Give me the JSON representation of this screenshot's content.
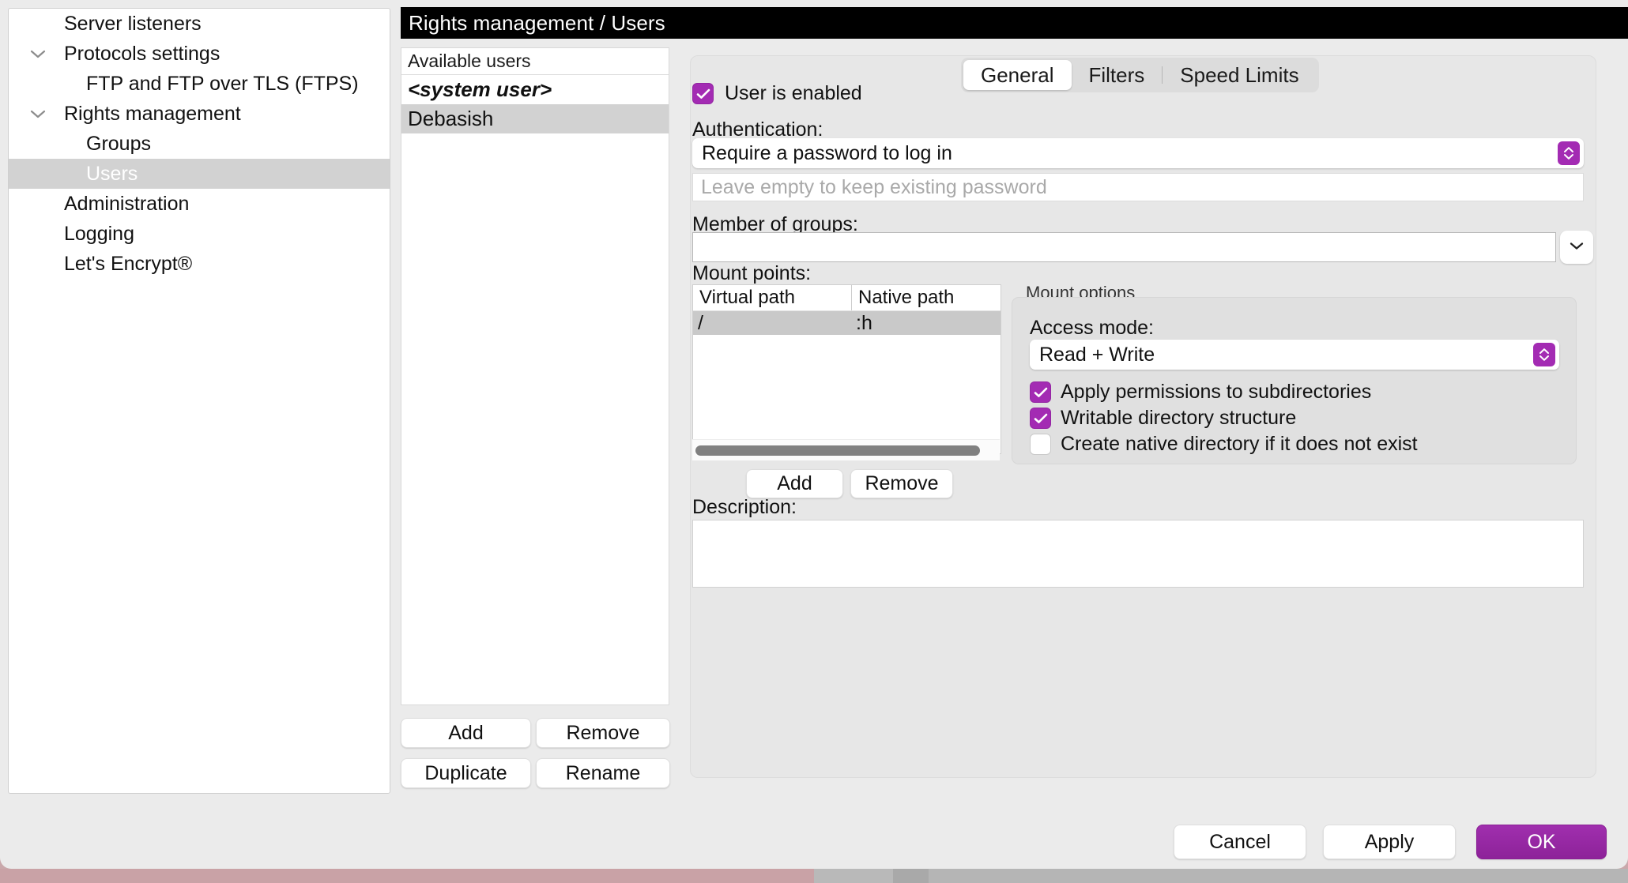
{
  "header": {
    "title": "Rights management / Users"
  },
  "sidebar": {
    "items": [
      {
        "label": "Server listeners",
        "indent": 1,
        "twisty": false,
        "selected": false
      },
      {
        "label": "Protocols settings",
        "indent": 1,
        "twisty": true,
        "selected": false
      },
      {
        "label": "FTP and FTP over TLS (FTPS)",
        "indent": 2,
        "twisty": false,
        "selected": false
      },
      {
        "label": "Rights management",
        "indent": 1,
        "twisty": true,
        "selected": false
      },
      {
        "label": "Groups",
        "indent": 2,
        "twisty": false,
        "selected": false
      },
      {
        "label": "Users",
        "indent": 2,
        "twisty": false,
        "selected": true
      },
      {
        "label": "Administration",
        "indent": 1,
        "twisty": false,
        "selected": false
      },
      {
        "label": "Logging",
        "indent": 1,
        "twisty": false,
        "selected": false
      },
      {
        "label": "Let's Encrypt®",
        "indent": 1,
        "twisty": false,
        "selected": false
      }
    ]
  },
  "users_panel": {
    "header": "Available users",
    "rows": [
      {
        "label": "<system user>",
        "italic": true,
        "selected": false
      },
      {
        "label": "Debasish",
        "italic": false,
        "selected": true
      }
    ],
    "buttons": {
      "add": "Add",
      "remove": "Remove",
      "duplicate": "Duplicate",
      "rename": "Rename"
    }
  },
  "tabs": [
    {
      "label": "General",
      "active": true
    },
    {
      "label": "Filters",
      "active": false
    },
    {
      "label": "Speed Limits",
      "active": false
    }
  ],
  "general": {
    "user_enabled": {
      "label": "User is enabled",
      "checked": true
    },
    "authentication": {
      "label": "Authentication:",
      "selected": "Require a password to log in"
    },
    "password": {
      "value": "",
      "placeholder": "Leave empty to keep existing password"
    },
    "member_of_groups": {
      "label": "Member of groups:",
      "value": ""
    },
    "mount_points": {
      "label": "Mount points:",
      "columns": [
        "Virtual path",
        "Native path"
      ],
      "rows": [
        {
          "virtual_path": "/",
          "native_path": ":h",
          "selected": true
        }
      ],
      "buttons": {
        "add": "Add",
        "remove": "Remove"
      }
    },
    "mount_options": {
      "title": "Mount options",
      "access_mode": {
        "label": "Access mode:",
        "selected": "Read + Write"
      },
      "checkboxes": [
        {
          "label": "Apply permissions to subdirectories",
          "checked": true
        },
        {
          "label": "Writable directory structure",
          "checked": true
        },
        {
          "label": "Create native directory if it does not exist",
          "checked": false
        }
      ]
    },
    "description": {
      "label": "Description:",
      "value": ""
    }
  },
  "actions": {
    "cancel": "Cancel",
    "apply": "Apply",
    "ok": "OK"
  },
  "colors": {
    "accent": "#a32bb3",
    "header_bar": "#000000",
    "selection": "#d2d2d2"
  }
}
